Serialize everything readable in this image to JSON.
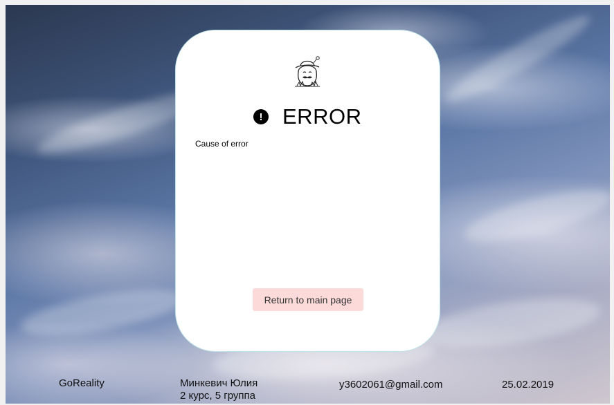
{
  "card": {
    "title": "ERROR",
    "alert_icon_glyph": "!",
    "cause_text": "Cause of error",
    "return_button_label": "Return to main page",
    "logo_icon": "egg-character-with-hat-logo"
  },
  "footer": {
    "brand": "GoReality",
    "author_name": "Минкевич Юлия",
    "author_group": "2 курс, 5 группа",
    "email": "y3602061@gmail.com",
    "date": "25.02.2019"
  },
  "colors": {
    "button_bg": "#fcdada",
    "card_border": "#bfe3e6",
    "card_bg": "#ffffff"
  }
}
